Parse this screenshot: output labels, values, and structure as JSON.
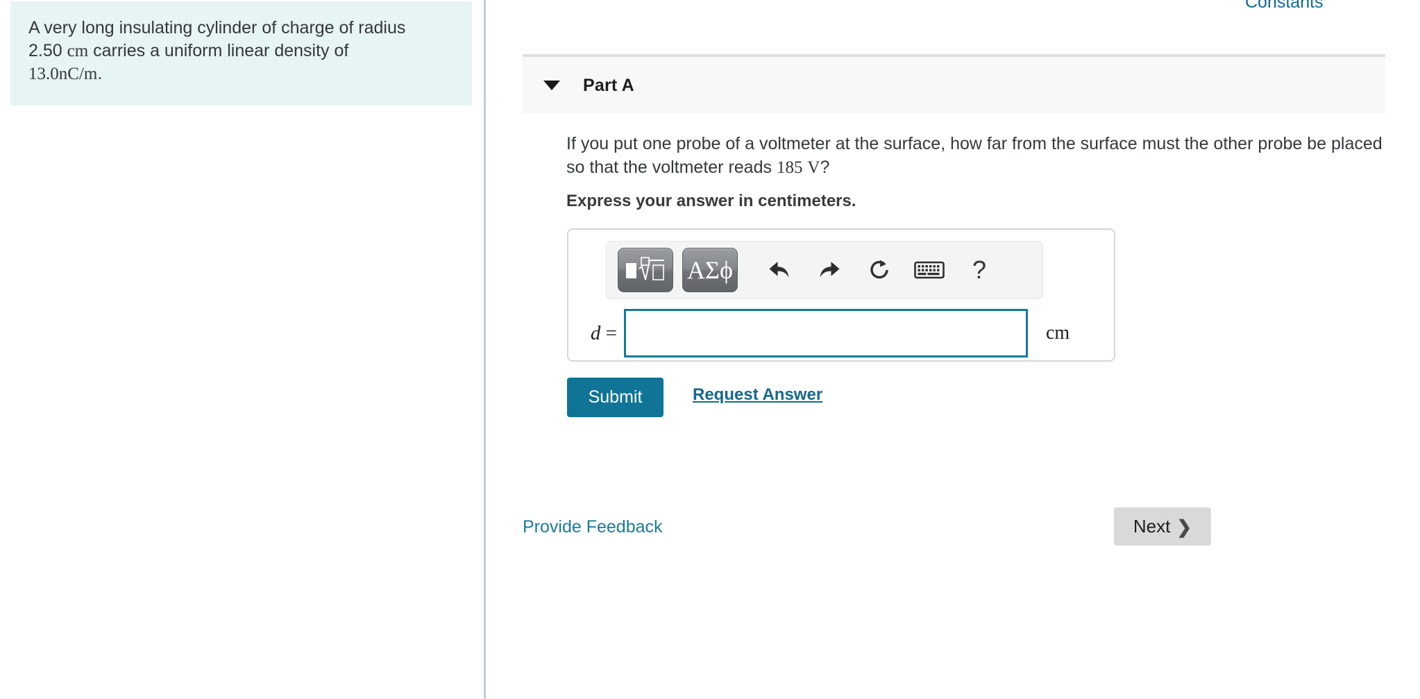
{
  "left_panel": {
    "problem_statement": {
      "line1": "A very long insulating cylinder of charge of radius",
      "line2_pre": "2.50",
      "line2_unit": "cm",
      "line2_post": "carries a uniform linear density of",
      "line3_value": "13.0",
      "line3_unit_num": "nC",
      "line3_unit_den": "m",
      "line3_period": "."
    }
  },
  "right_panel": {
    "constants_label": "Constants",
    "part": {
      "title": "Part A",
      "caret_icon": "caret-down-icon",
      "question_line1": "If you put one probe of a voltmeter at the surface, how far from the surface must the other probe be",
      "question_line2_pre": "placed so that the voltmeter reads",
      "question_value": "185",
      "question_unit": "V",
      "question_line2_post": "?",
      "answer_format_note": "Express your answer in centimeters."
    },
    "answer_widget": {
      "toolbar": {
        "math_template_label": "math-template-button",
        "greek_label": "ΑΣϕ",
        "undo_label": "undo-button",
        "redo_label": "redo-button",
        "reset_label": "reset-button",
        "keyboard_label": "keyboard-button",
        "help_label": "?"
      },
      "variable": "d",
      "equals": "=",
      "value": "",
      "placeholder": "",
      "unit": "cm"
    },
    "actions": {
      "submit_label": "Submit",
      "request_answer_label": "Request Answer"
    },
    "footer": {
      "provide_feedback_label": "Provide Feedback",
      "next_label": "Next",
      "next_chevron_icon": "chevron-right-icon"
    }
  },
  "colors": {
    "problem_box_bg": "#e6f4f3",
    "accent_teal": "#0f7496",
    "link_blue": "#15698c",
    "divider": "#c2cfdd",
    "panel_header_bg": "#f8f8f8",
    "next_button_bg": "#d9d9d9",
    "input_border": "#127a9c"
  }
}
